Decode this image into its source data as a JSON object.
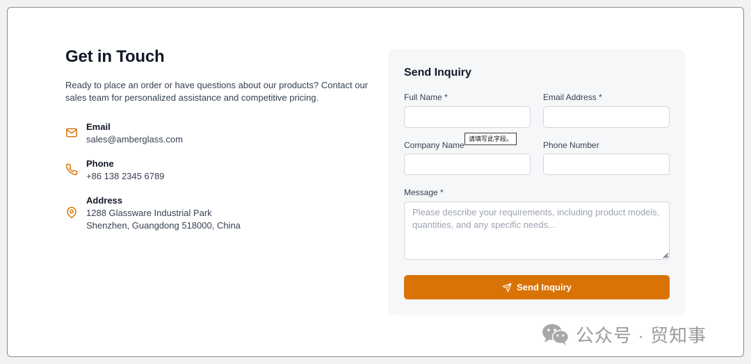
{
  "contact": {
    "title": "Get in Touch",
    "description": "Ready to place an order or have questions about our products? Contact our sales team for personalized assistance and competitive pricing.",
    "items": [
      {
        "label": "Email",
        "value": "sales@amberglass.com",
        "icon": "mail-icon"
      },
      {
        "label": "Phone",
        "value": "+86 138 2345 6789",
        "icon": "phone-icon"
      },
      {
        "label": "Address",
        "value_line1": "1288 Glassware Industrial Park",
        "value_line2": "Shenzhen, Guangdong 518000, China",
        "icon": "map-pin-icon"
      }
    ]
  },
  "form": {
    "title": "Send Inquiry",
    "full_name_label": "Full Name *",
    "email_label": "Email Address *",
    "company_label": "Company Name",
    "phone_label": "Phone Number",
    "message_label": "Message *",
    "message_placeholder": "Please describe your requirements, including product models, quantities, and any specific needs...",
    "submit_label": "Send Inquiry"
  },
  "validation_tooltip": "请填写此字段。",
  "watermark": {
    "text": "公众号 · 贸知事",
    "icon": "wechat-icon"
  },
  "colors": {
    "accent": "#d97306",
    "card_bg": "#f6f7f9"
  }
}
